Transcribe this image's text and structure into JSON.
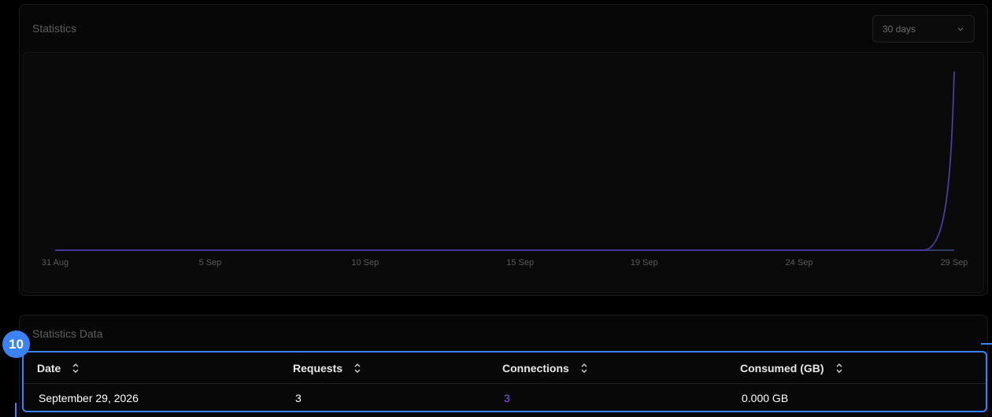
{
  "statistics": {
    "title": "Statistics",
    "range": {
      "selected": "30 days",
      "icon": "chevron-down-icon"
    }
  },
  "chart_data": {
    "type": "line",
    "x": [
      "31 Aug",
      "1 Sep",
      "2 Sep",
      "3 Sep",
      "4 Sep",
      "5 Sep",
      "6 Sep",
      "7 Sep",
      "8 Sep",
      "9 Sep",
      "10 Sep",
      "11 Sep",
      "12 Sep",
      "13 Sep",
      "14 Sep",
      "15 Sep",
      "16 Sep",
      "17 Sep",
      "18 Sep",
      "19 Sep",
      "20 Sep",
      "21 Sep",
      "22 Sep",
      "23 Sep",
      "24 Sep",
      "25 Sep",
      "26 Sep",
      "27 Sep",
      "28 Sep",
      "29 Sep"
    ],
    "tick_labels": [
      "31 Aug",
      "5 Sep",
      "10 Sep",
      "15 Sep",
      "19 Sep",
      "24 Sep",
      "29 Sep"
    ],
    "series": [
      {
        "values": [
          0,
          0,
          0,
          0,
          0,
          0,
          0,
          0,
          0,
          0,
          0,
          0,
          0,
          0,
          0,
          0,
          0,
          0,
          0,
          0,
          0,
          0,
          0,
          0,
          0,
          0,
          0,
          0,
          0,
          3
        ],
        "color": "#4c3aa3"
      }
    ],
    "baseline_color": "#3b4a7a",
    "title": "",
    "xlabel": "",
    "ylabel": "",
    "ylim": [
      0,
      3
    ],
    "grid": false
  },
  "statistics_data": {
    "title": "Statistics Data",
    "columns": [
      "Date",
      "Requests",
      "Connections",
      "Consumed (GB)"
    ],
    "rows": [
      {
        "date": "September 29, 2026",
        "requests": "3",
        "connections": "3",
        "consumed": "0.000 GB"
      }
    ]
  },
  "annotation": {
    "marker": "10",
    "color": "#3b82f6"
  }
}
